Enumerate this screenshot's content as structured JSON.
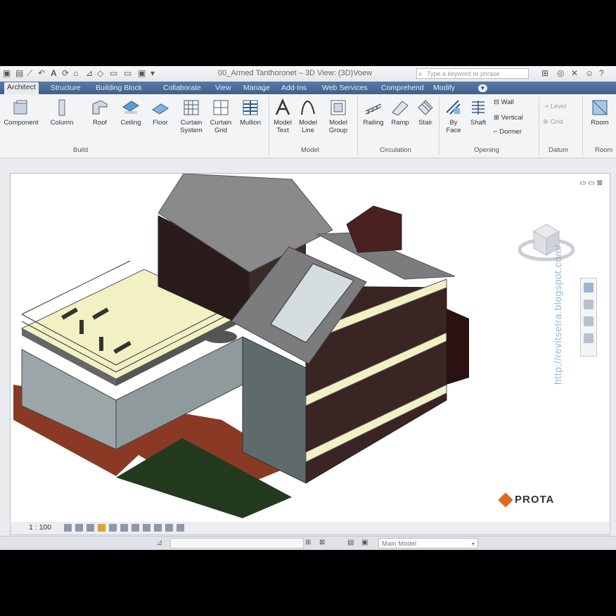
{
  "window": {
    "title": "00_Armed Tanthoronet – 3D View: (3D)Voew",
    "search_placeholder": "Type a keyword or phrase"
  },
  "menu": {
    "tabs": [
      "Architect",
      "Structure",
      "Building Block",
      "Collaborate",
      "View",
      "Manage",
      "Add-Ins",
      "Web Services",
      "Comprehend",
      "Modify"
    ]
  },
  "ribbon": {
    "tools": [
      {
        "label": "Component",
        "icon": "component-icon"
      },
      {
        "label": "Column",
        "icon": "column-icon"
      },
      {
        "label": "Roof",
        "icon": "roof-icon"
      },
      {
        "label": "Ceiling",
        "icon": "ceiling-icon"
      },
      {
        "label": "Floor",
        "icon": "floor-icon"
      },
      {
        "label": "Curtain System",
        "icon": "curtain-system-icon"
      },
      {
        "label": "Curtain Grid",
        "icon": "curtain-grid-icon"
      },
      {
        "label": "Mullion",
        "icon": "mullion-icon"
      },
      {
        "label": "Model Text",
        "icon": "model-text-icon"
      },
      {
        "label": "Model Line",
        "icon": "model-line-icon"
      },
      {
        "label": "Model Group",
        "icon": "model-group-icon"
      },
      {
        "label": "Railing",
        "icon": "railing-icon"
      },
      {
        "label": "Ramp",
        "icon": "ramp-icon"
      },
      {
        "label": "Stair",
        "icon": "stair-icon"
      },
      {
        "label": "By Face",
        "icon": "by-face-icon"
      },
      {
        "label": "Shaft",
        "icon": "shaft-icon"
      },
      {
        "label": "Room",
        "icon": "room-icon"
      }
    ],
    "small_items": [
      "Wall",
      "Vertical",
      "Dormer"
    ],
    "datum_items": [
      "Level",
      "Grid"
    ],
    "panels": [
      "Build",
      "Model",
      "Circulation",
      "Opening",
      "Datum",
      "Room"
    ]
  },
  "view": {
    "scale": "1 : 100",
    "watermark": "http://revitsetra.blogspot.com/",
    "brand": "PROTA",
    "controls": "▭ ▭ ⊠"
  },
  "status": {
    "model_selector": "Main Model"
  },
  "colors": {
    "menubar": "#4a6a96",
    "roof": "#8a8a8c",
    "floor_slab": "#f1f1c4",
    "deck": "#8a3a24",
    "lawn": "#233a1e",
    "brand_orange": "#e0681e"
  }
}
